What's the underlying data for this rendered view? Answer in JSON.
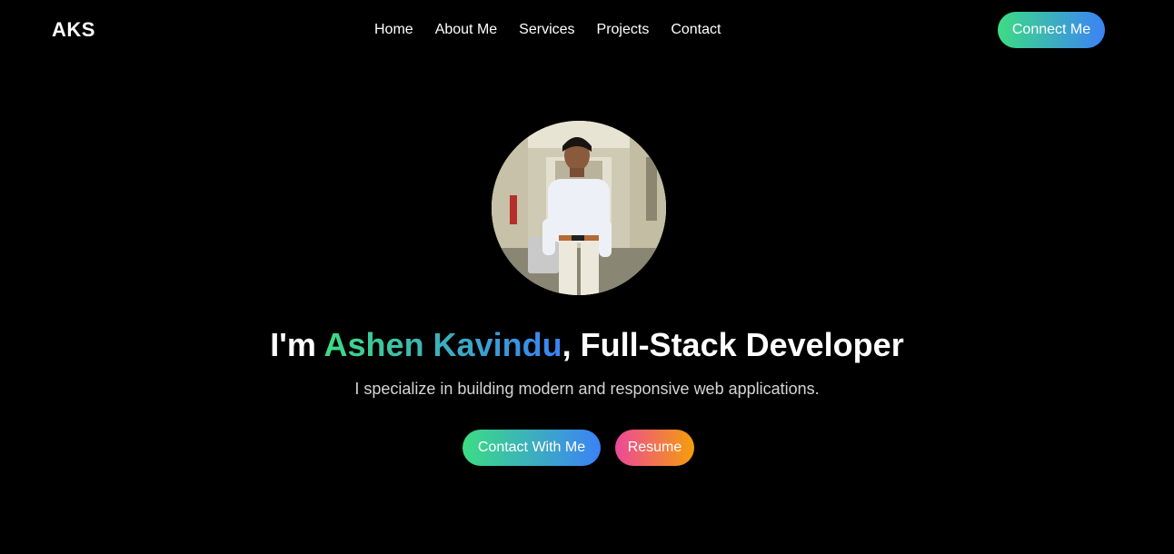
{
  "navbar": {
    "logo": "AKS",
    "links": [
      "Home",
      "About Me",
      "Services",
      "Projects",
      "Contact"
    ],
    "cta_label": "Connect Me"
  },
  "hero": {
    "title_prefix": "I'm ",
    "name": "Ashen Kavindu",
    "title_suffix": ", Full-Stack Developer",
    "subtitle": "I specialize in building modern and responsive web applications.",
    "buttons": {
      "contact_label": "Contact With Me",
      "resume_label": "Resume"
    }
  },
  "colors": {
    "background": "#000000",
    "gradient_green": "#3ddc84",
    "gradient_blue": "#3b82f6",
    "gradient_pink": "#ec4899",
    "gradient_orange": "#f59e0b"
  }
}
